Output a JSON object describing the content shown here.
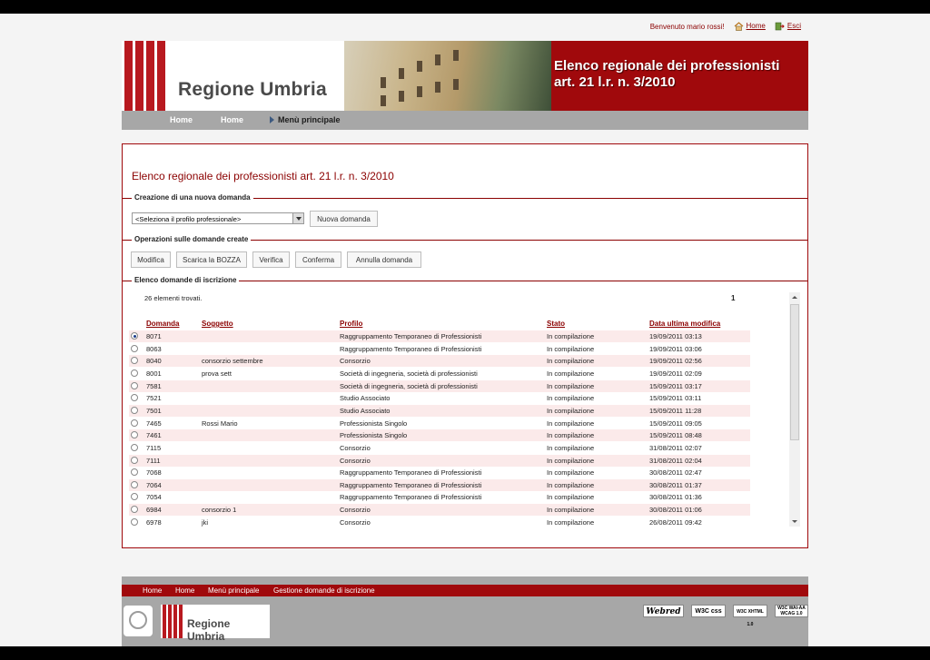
{
  "userbar": {
    "welcome": "Benvenuto mario rossi!",
    "home": "Home",
    "exit": "Esci"
  },
  "header": {
    "region": "Regione Umbria",
    "banner_title_line1": "Elenco regionale dei professionisti",
    "banner_title_line2": "art. 21 l.r. n. 3/2010"
  },
  "nav": {
    "item1": "Home",
    "item2": "Home",
    "current": "Menù principale"
  },
  "panel": {
    "title": "Elenco regionale dei professionisti art. 21 l.r. n. 3/2010",
    "section_new": "Creazione di una nuova domanda",
    "select_placeholder": "<Seleziona il profilo professionale>",
    "new_button": "Nuova domanda",
    "section_ops": "Operazioni sulle domande create",
    "ops": {
      "modify": "Modifica",
      "download": "Scarica la BOZZA",
      "verify": "Verifica",
      "confirm": "Conferma",
      "cancel": "Annulla domanda"
    },
    "section_list": "Elenco domande di iscrizione",
    "count": "26 elementi trovati.",
    "page": "1"
  },
  "table": {
    "headers": {
      "domanda": "Domanda",
      "soggetto": "Soggetto",
      "profilo": "Profilo",
      "stato": "Stato",
      "data": "Data ultima modifica"
    },
    "rows": [
      {
        "domanda": "8071",
        "soggetto": "",
        "profilo": "Raggruppamento Temporaneo di Professionisti",
        "stato": "In compilazione",
        "data": "19/09/2011 03:13"
      },
      {
        "domanda": "8063",
        "soggetto": "",
        "profilo": "Raggruppamento Temporaneo di Professionisti",
        "stato": "In compilazione",
        "data": "19/09/2011 03:06"
      },
      {
        "domanda": "8040",
        "soggetto": "consorzio settembre",
        "profilo": "Consorzio",
        "stato": "In compilazione",
        "data": "19/09/2011 02:56"
      },
      {
        "domanda": "8001",
        "soggetto": "prova sett",
        "profilo": "Società di ingegneria, società di professionisti",
        "stato": "In compilazione",
        "data": "19/09/2011 02:09"
      },
      {
        "domanda": "7581",
        "soggetto": "",
        "profilo": "Società di ingegneria, società di professionisti",
        "stato": "In compilazione",
        "data": "15/09/2011 03:17"
      },
      {
        "domanda": "7521",
        "soggetto": "",
        "profilo": "Studio Associato",
        "stato": "In compilazione",
        "data": "15/09/2011 03:11"
      },
      {
        "domanda": "7501",
        "soggetto": "",
        "profilo": "Studio Associato",
        "stato": "In compilazione",
        "data": "15/09/2011 11:28"
      },
      {
        "domanda": "7465",
        "soggetto": "Rossi Mario",
        "profilo": "Professionista Singolo",
        "stato": "In compilazione",
        "data": "15/09/2011 09:05"
      },
      {
        "domanda": "7461",
        "soggetto": "",
        "profilo": "Professionista Singolo",
        "stato": "In compilazione",
        "data": "15/09/2011 08:48"
      },
      {
        "domanda": "7115",
        "soggetto": "",
        "profilo": "Consorzio",
        "stato": "In compilazione",
        "data": "31/08/2011 02:07"
      },
      {
        "domanda": "7111",
        "soggetto": "",
        "profilo": "Consorzio",
        "stato": "In compilazione",
        "data": "31/08/2011 02:04"
      },
      {
        "domanda": "7068",
        "soggetto": "",
        "profilo": "Raggruppamento Temporaneo di Professionisti",
        "stato": "In compilazione",
        "data": "30/08/2011 02:47"
      },
      {
        "domanda": "7064",
        "soggetto": "",
        "profilo": "Raggruppamento Temporaneo di Professionisti",
        "stato": "In compilazione",
        "data": "30/08/2011 01:37"
      },
      {
        "domanda": "7054",
        "soggetto": "",
        "profilo": "Raggruppamento Temporaneo di Professionisti",
        "stato": "In compilazione",
        "data": "30/08/2011 01:36"
      },
      {
        "domanda": "6984",
        "soggetto": "consorzio 1",
        "profilo": "Consorzio",
        "stato": "In compilazione",
        "data": "30/08/2011 01:06"
      },
      {
        "domanda": "6978",
        "soggetto": "jki",
        "profilo": "Consorzio",
        "stato": "In compilazione",
        "data": "26/08/2011 09:42"
      }
    ]
  },
  "footer": {
    "nav": {
      "item1": "Home",
      "item2": "Home",
      "item3": "Menù principale",
      "item4": "Gestione domande di iscrizione"
    },
    "region": "Regione Umbria",
    "badges": {
      "webred": "Webred",
      "css": "W3C css",
      "xhtml": "W3C XHTML 1.0",
      "wai": "W3C WAI-AA WCAG 1.0"
    }
  },
  "colors": {
    "brand_red": "#a0090c",
    "nav_grey": "#a7a7a7",
    "link": "#8b0000"
  },
  "icons": [
    "home-icon",
    "exit-icon",
    "dropdown-arrow-icon",
    "radio-button",
    "scroll-up-icon",
    "scroll-down-icon",
    "emblem-icon"
  ]
}
